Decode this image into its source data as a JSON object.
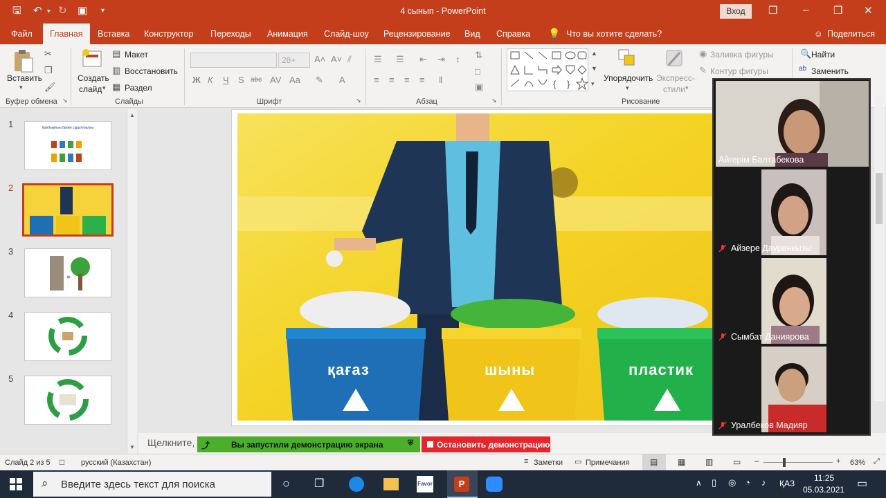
{
  "window": {
    "title": "4 сынып  -  PowerPoint",
    "signin": "Вход"
  },
  "tabs": [
    "Файл",
    "Главная",
    "Вставка",
    "Конструктор",
    "Переходы",
    "Анимация",
    "Слайд-шоу",
    "Рецензирование",
    "Вид",
    "Справка"
  ],
  "active_tab": "Главная",
  "tell_me": "Что вы хотите сделать?",
  "share": "Поделиться",
  "ribbon": {
    "clipboard": {
      "paste": "Вставить",
      "group": "Буфер обмена"
    },
    "slides": {
      "new_slide_1": "Создать",
      "new_slide_2": "слайд",
      "layout": "Макет",
      "reset": "Восстановить",
      "section": "Раздел",
      "group": "Слайды"
    },
    "font": {
      "size": "28+",
      "group": "Шрифт"
    },
    "paragraph": {
      "group": "Абзац"
    },
    "drawing": {
      "arrange": "Упорядочить",
      "styles_1": "Экспресс-",
      "styles_2": "стили",
      "fill": "Заливка фигуры",
      "outline": "Контур фигуры",
      "group": "Рисование"
    },
    "editing": {
      "find": "Найти",
      "replace": "Заменить"
    }
  },
  "slides": [
    {
      "num": "1",
      "caption": "Қалдықтың бөлек сұрыпталуы"
    },
    {
      "num": "2"
    },
    {
      "num": "3"
    },
    {
      "num": "4"
    },
    {
      "num": "5"
    }
  ],
  "selected_slide": 2,
  "slide2": {
    "bin_1": "қағаз",
    "bin_2": "шыны",
    "bin_3": "пластик"
  },
  "notes_placeholder": "Щелкните,",
  "screen_share": {
    "notice": "Вы запустили демонстрацию экрана",
    "stop": "Остановить демонстрацию"
  },
  "participants": [
    {
      "name": "Айгерім Балтабекова",
      "muted": false
    },
    {
      "name": "Айзере Дауренкызы",
      "muted": true
    },
    {
      "name": "Сымбат Даниярова",
      "muted": true
    },
    {
      "name": "Уралбеков Мадияр",
      "muted": true
    }
  ],
  "status": {
    "slide": "Слайд 2 из 5",
    "language": "русский (Казахстан)",
    "notes": "Заметки",
    "comments": "Примечания",
    "zoom": "63%"
  },
  "taskbar": {
    "search_placeholder": "Введите здесь текст для поиска",
    "keyboard": "ҚАЗ",
    "time": "11:25",
    "date": "05.03.2021",
    "app_favori": "Favor"
  },
  "colors": {
    "accent": "#c43e1c",
    "share_green": "#4caf2c",
    "stop_red": "#e4262c",
    "taskbar": "#1f2a3a"
  }
}
